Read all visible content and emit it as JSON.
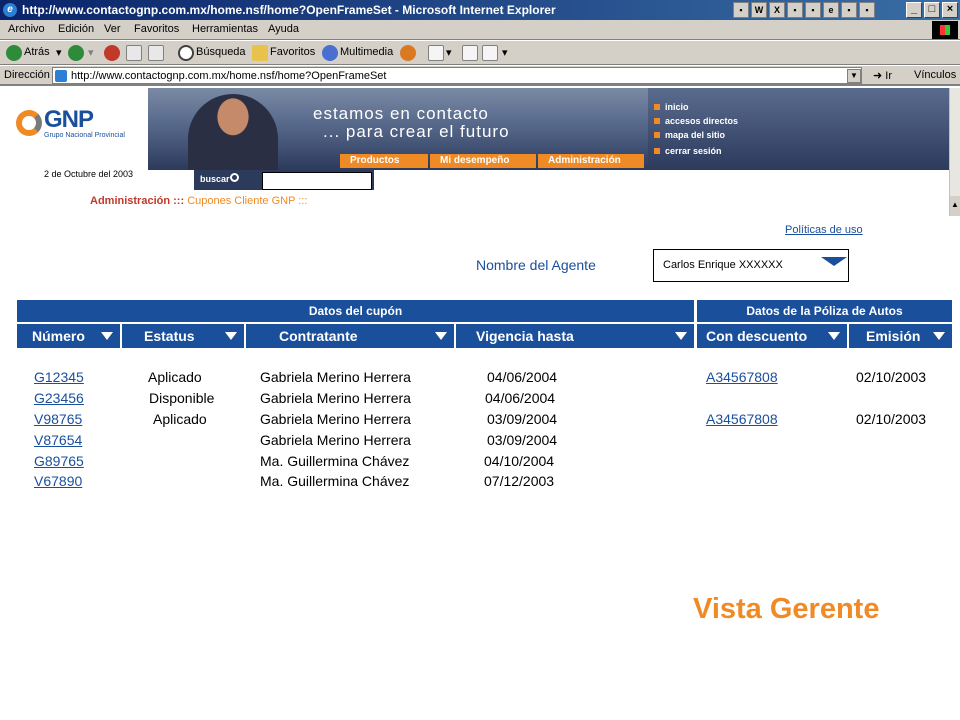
{
  "window": {
    "title": "http://www.contactognp.com.mx/home.nsf/home?OpenFrameSet - Microsoft Internet Explorer",
    "min": "_",
    "max": "□",
    "close": "×"
  },
  "menu": [
    "Archivo",
    "Edición",
    "Ver",
    "Favoritos",
    "Herramientas",
    "Ayuda"
  ],
  "toolbar": {
    "back": "Atrás",
    "search": "Búsqueda",
    "favorites": "Favoritos",
    "media": "Multimedia"
  },
  "address": {
    "label": "Dirección",
    "url": "http://www.contactognp.com.mx/home.nsf/home?OpenFrameSet",
    "go": "Ir",
    "links": "Vínculos"
  },
  "header": {
    "logo_text": "GNP",
    "logo_sub": "Grupo Nacional Provincial",
    "date": "2 de Octubre del 2003",
    "slogan_1": "estamos en contacto",
    "slogan_2": "... para crear el futuro",
    "nav": [
      "Productos",
      "Mi desempeño",
      "Administración"
    ],
    "side_links": [
      "inicio",
      "accesos directos",
      "mapa del sitio",
      "cerrar sesión"
    ],
    "search_label": "buscar"
  },
  "breadcrumb": {
    "section": "Administración :::",
    "page": "Cupones Cliente GNP :::"
  },
  "policy_link": "Políticas de uso",
  "agent": {
    "label": "Nombre del Agente",
    "selected": "Carlos Enrique XXXXXX"
  },
  "table": {
    "groups": [
      "Datos del cupón",
      "Datos de la Póliza de Autos"
    ],
    "columns": [
      "Número",
      "Estatus",
      "Contratante",
      "Vigencia hasta",
      "Con descuento",
      "Emisión"
    ],
    "rows": [
      {
        "numero": "G12345",
        "estatus": "Aplicado",
        "contratante": "Gabriela Merino Herrera",
        "vigencia": "04/06/2004",
        "poliza": "A34567808",
        "emision": "02/10/2003"
      },
      {
        "numero": "G23456",
        "estatus": "Disponible",
        "contratante": "Gabriela Merino Herrera",
        "vigencia": "04/06/2004",
        "poliza": "",
        "emision": ""
      },
      {
        "numero": "V98765",
        "estatus": "Aplicado",
        "contratante": "Gabriela Merino Herrera",
        "vigencia": "03/09/2004",
        "poliza": "A34567808",
        "emision": "02/10/2003"
      },
      {
        "numero": "V87654",
        "estatus": "",
        "contratante": "Gabriela Merino Herrera",
        "vigencia": "03/09/2004",
        "poliza": "",
        "emision": ""
      },
      {
        "numero": "G89765",
        "estatus": "",
        "contratante": "Ma. Guillermina Chávez",
        "vigencia": "04/10/2004",
        "poliza": "",
        "emision": ""
      },
      {
        "numero": "V67890",
        "estatus": "",
        "contratante": "Ma. Guillermina Chávez",
        "vigencia": "07/12/2003",
        "poliza": "",
        "emision": ""
      }
    ]
  },
  "caption": "Vista Gerente",
  "colors": {
    "brand_blue": "#1a4f9c",
    "brand_orange": "#f08a24"
  }
}
